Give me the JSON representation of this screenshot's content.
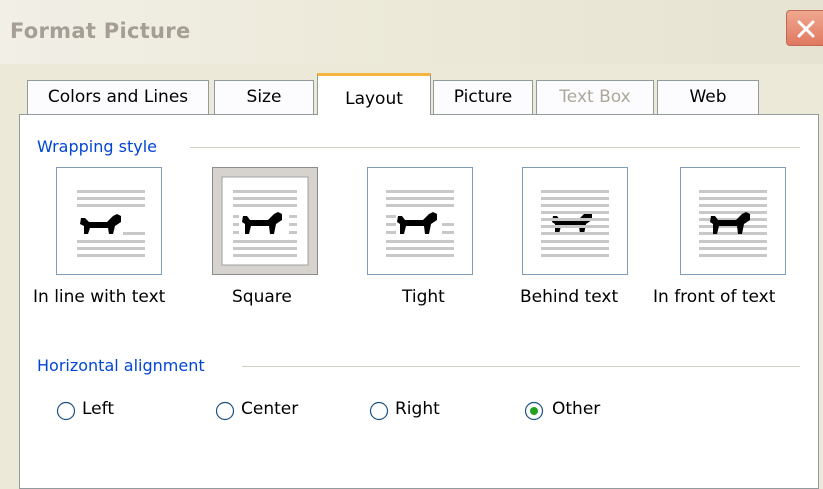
{
  "dialog": {
    "title": "Format Picture",
    "close_icon": "close-x-icon"
  },
  "tabs": [
    {
      "label": "Colors and Lines",
      "state": "normal"
    },
    {
      "label": "Size",
      "state": "normal"
    },
    {
      "label": "Layout",
      "state": "active"
    },
    {
      "label": "Picture",
      "state": "normal"
    },
    {
      "label": "Text Box",
      "state": "disabled"
    },
    {
      "label": "Web",
      "state": "normal"
    }
  ],
  "wrapping": {
    "heading": "Wrapping style",
    "selected": "Square",
    "options": [
      {
        "label": "In line with text",
        "icon": "inline-with-text-icon"
      },
      {
        "label": "Square",
        "icon": "square-wrap-icon"
      },
      {
        "label": "Tight",
        "icon": "tight-wrap-icon"
      },
      {
        "label": "Behind text",
        "icon": "behind-text-icon"
      },
      {
        "label": "In front of text",
        "icon": "in-front-of-text-icon"
      }
    ]
  },
  "alignment": {
    "heading": "Horizontal alignment",
    "selected": "Other",
    "options": [
      {
        "label": "Left"
      },
      {
        "label": "Center"
      },
      {
        "label": "Right"
      },
      {
        "label": "Other"
      }
    ]
  },
  "colors": {
    "accent_blue": "#0046d5",
    "active_tab_highlight": "#f6b53f",
    "disabled_text": "#aca899",
    "close_button": "#e07860"
  }
}
